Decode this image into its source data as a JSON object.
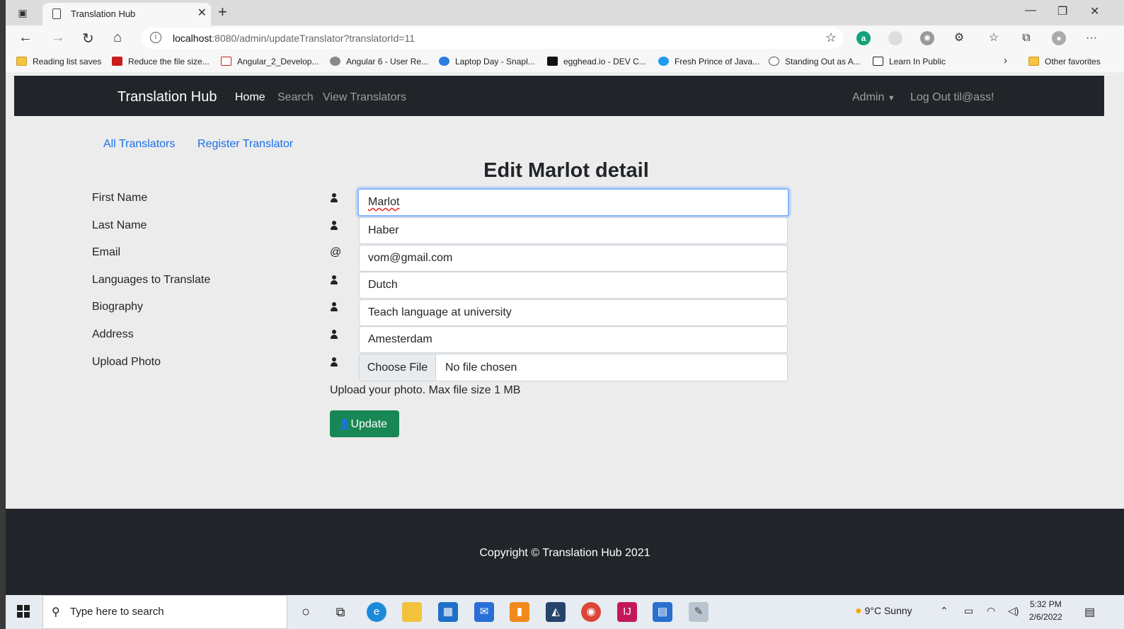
{
  "browser": {
    "tab_title": "Translation Hub",
    "tab_close": "✕",
    "new_tab": "+",
    "url_host": "localhost",
    "url_rest": ":8080/admin/updateTranslator?translatorId=11",
    "bookmarks": [
      "Reading list saves",
      "Reduce the file size...",
      "Angular_2_Develop...",
      "Angular 6 - User Re...",
      "Laptop Day - Snapl...",
      "egghead.io - DEV C...",
      "Fresh Prince of Java...",
      "Standing Out as A...",
      "Learn In Public"
    ],
    "other_favorites": "Other favorites"
  },
  "navbar": {
    "brand": "Translation Hub",
    "links": [
      "Home",
      "Search",
      "View Translators"
    ],
    "admin": "Admin",
    "logout": "Log Out til@ass!"
  },
  "sublinks": [
    "All Translators",
    "Register Translator"
  ],
  "form": {
    "heading": "Edit Marlot detail",
    "labels": [
      "First Name",
      "Last Name",
      "Email",
      "Languages to Translate",
      "Biography",
      "Address",
      "Upload Photo"
    ],
    "values": {
      "first_name": "Marlot",
      "last_name": "Haber",
      "email": "vom@gmail.com",
      "languages": "Dutch",
      "biography": "Teach language at university",
      "address": "Amesterdam"
    },
    "email_icon": "@",
    "file_button": "Choose File",
    "file_status": "No file chosen",
    "help": "Upload your photo. Max file size 1 MB",
    "submit": "Update"
  },
  "footer": {
    "copyright": "Copyright © Translation Hub 2021"
  },
  "taskbar": {
    "search_placeholder": "Type here to search",
    "weather": "9°C  Sunny",
    "time": "5:32 PM",
    "date": "2/6/2022"
  },
  "colors": {
    "navbar_bg": "#212529",
    "link": "#1a6fe8",
    "update_button": "#198754"
  }
}
